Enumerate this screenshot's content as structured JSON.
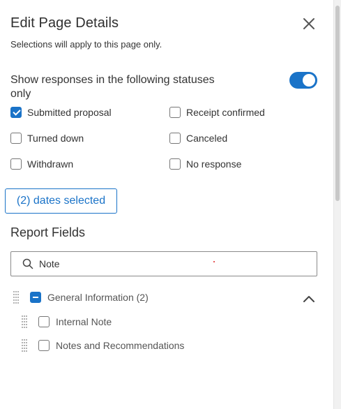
{
  "panel": {
    "title": "Edit Page Details",
    "subtitle": "Selections will apply to this page only."
  },
  "status_filter": {
    "label": "Show responses in the following statuses only",
    "toggle_on": true,
    "options": [
      {
        "label": "Submitted proposal",
        "checked": true
      },
      {
        "label": "Receipt confirmed",
        "checked": false
      },
      {
        "label": "Turned down",
        "checked": false
      },
      {
        "label": "Canceled",
        "checked": false
      },
      {
        "label": "Withdrawn",
        "checked": false
      },
      {
        "label": "No response",
        "checked": false
      }
    ]
  },
  "dates_button": {
    "label": "(2) dates selected"
  },
  "report_fields": {
    "title": "Report Fields",
    "search_value": "Note",
    "group": {
      "label": "General Information (2)",
      "state": "partial",
      "expanded": true
    },
    "items": [
      {
        "label": "Internal Note",
        "checked": false
      },
      {
        "label": "Notes and Recommendations",
        "checked": false
      }
    ]
  },
  "icons": {
    "close": "close-icon",
    "search": "search-icon",
    "drag": "drag-handle-icon",
    "collapse": "chevron-up-icon"
  },
  "colors": {
    "accent": "#1a73c8",
    "text": "#333333",
    "muted": "#555555"
  }
}
